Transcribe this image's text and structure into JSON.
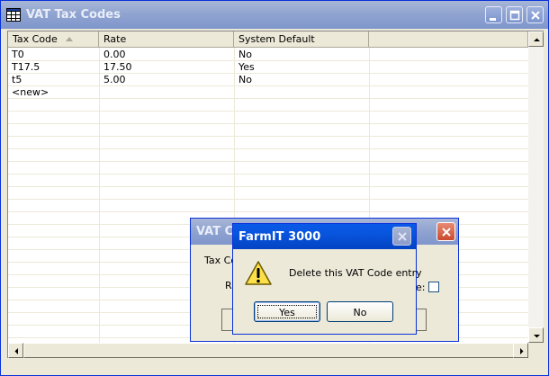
{
  "window": {
    "title": "VAT Tax Codes",
    "icon": "grid-icon"
  },
  "grid": {
    "columns": [
      "Tax Code",
      "Rate",
      "System Default"
    ],
    "rows": [
      [
        "T0",
        "0.00",
        "No"
      ],
      [
        "T17.5",
        "17.50",
        "Yes"
      ],
      [
        "t5",
        "5.00",
        "No"
      ],
      [
        "<new>",
        "",
        ""
      ]
    ]
  },
  "background_dialog": {
    "title": "VAT Co",
    "label_code": "Tax Co",
    "label_rate": "R",
    "label_default": "e:"
  },
  "message_box": {
    "title": "FarmIT 3000",
    "message": "Delete this VAT Code entry",
    "icon": "warning-icon",
    "yes_label": "Yes",
    "no_label": "No"
  },
  "colors": {
    "active_title": "#0855dd",
    "inactive_title": "#8fa3d0",
    "face": "#ece9d8"
  }
}
